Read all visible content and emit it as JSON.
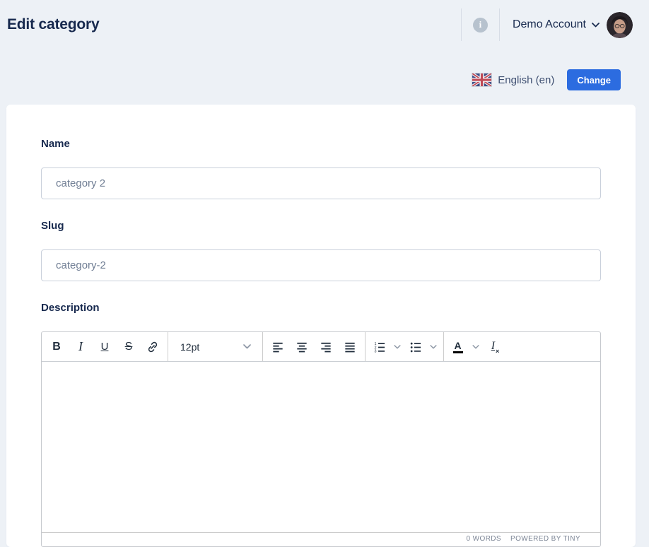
{
  "header": {
    "title": "Edit category",
    "account_label": "Demo Account"
  },
  "language_bar": {
    "language_label": "English (en)",
    "change_button_label": "Change",
    "flag": "uk-flag"
  },
  "form": {
    "name_label": "Name",
    "name_value": "category 2",
    "slug_label": "Slug",
    "slug_value": "category-2",
    "description_label": "Description"
  },
  "editor": {
    "toolbar": {
      "bold_glyph": "B",
      "italic_glyph": "I",
      "underline_glyph": "U",
      "strike_glyph": "S",
      "font_size_value": "12pt",
      "forecolor_glyph": "A",
      "clearformat_glyph": "I",
      "clearformat_sub": "×"
    },
    "statusbar": {
      "word_count": "0 WORDS",
      "branding": "POWERED BY TINY"
    }
  },
  "colors": {
    "page_background": "#edf1f6",
    "heading_text": "#17294e",
    "accent_blue": "#2c6ce0",
    "toolbar_icon": "#222f3e",
    "input_text": "#6f7d93"
  }
}
